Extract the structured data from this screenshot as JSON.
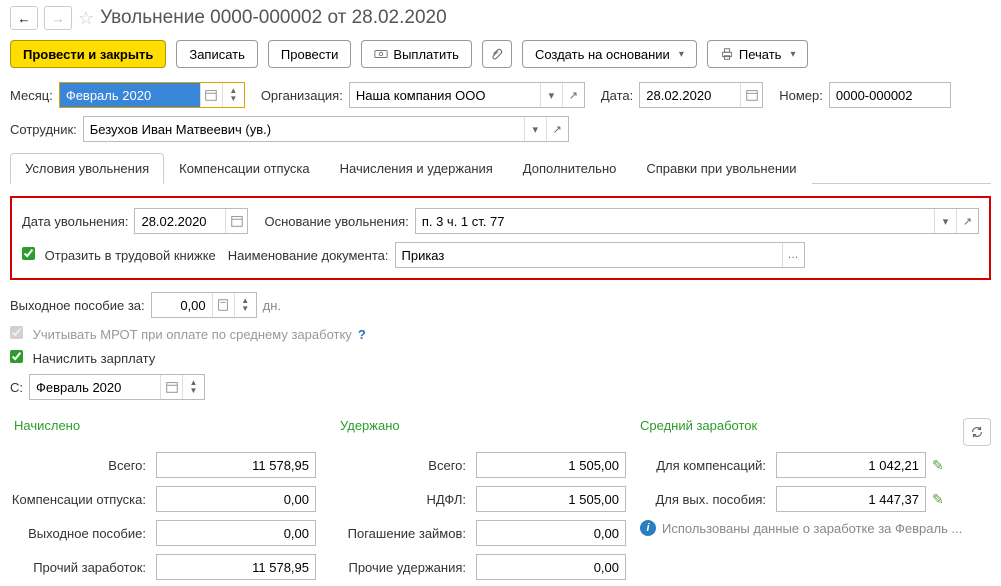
{
  "header": {
    "title": "Увольнение 0000-000002 от 28.02.2020"
  },
  "toolbar": {
    "post_close": "Провести и закрыть",
    "save": "Записать",
    "post": "Провести",
    "pay": "Выплатить",
    "create_based": "Создать на основании",
    "print": "Печать"
  },
  "form": {
    "month_label": "Месяц:",
    "month_value": "Февраль 2020",
    "org_label": "Организация:",
    "org_value": "Наша компания ООО",
    "date_label": "Дата:",
    "date_value": "28.02.2020",
    "number_label": "Номер:",
    "number_value": "0000-000002",
    "employee_label": "Сотрудник:",
    "employee_value": "Безухов Иван Матвеевич (ув.)"
  },
  "tabs": [
    {
      "label": "Условия увольнения"
    },
    {
      "label": "Компенсации отпуска"
    },
    {
      "label": "Начисления и удержания"
    },
    {
      "label": "Дополнительно"
    },
    {
      "label": "Справки при увольнении"
    }
  ],
  "dismissal": {
    "date_label": "Дата увольнения:",
    "date_value": "28.02.2020",
    "basis_label": "Основание увольнения:",
    "basis_value": "п. 3 ч. 1 ст. 77",
    "workbook_label": "Отразить в трудовой книжке",
    "docname_label": "Наименование документа:",
    "docname_value": "Приказ"
  },
  "severance": {
    "label": "Выходное пособие за:",
    "value": "0,00",
    "unit": "дн."
  },
  "checks": {
    "mrot": "Учитывать МРОТ при оплате по среднему заработку",
    "accrue_salary": "Начислить зарплату"
  },
  "from": {
    "label": "С:",
    "value": "Февраль 2020"
  },
  "totals": {
    "accrued_h": "Начислено",
    "withheld_h": "Удержано",
    "avg_h": "Средний заработок",
    "accrued": {
      "total": {
        "label": "Всего:",
        "value": "11 578,95"
      },
      "vacation_comp": {
        "label": "Компенсации отпуска:",
        "value": "0,00"
      },
      "severance": {
        "label": "Выходное пособие:",
        "value": "0,00"
      },
      "other": {
        "label": "Прочий заработок:",
        "value": "11 578,95"
      }
    },
    "withheld": {
      "total": {
        "label": "Всего:",
        "value": "1 505,00"
      },
      "ndfl": {
        "label": "НДФЛ:",
        "value": "1 505,00"
      },
      "loans": {
        "label": "Погашение займов:",
        "value": "0,00"
      },
      "other": {
        "label": "Прочие удержания:",
        "value": "0,00"
      }
    },
    "avg": {
      "comp": {
        "label": "Для компенсаций:",
        "value": "1 042,21"
      },
      "sev": {
        "label": "Для вых. пособия:",
        "value": "1 447,37"
      },
      "info": "Использованы данные о заработке за Февраль ..."
    }
  }
}
